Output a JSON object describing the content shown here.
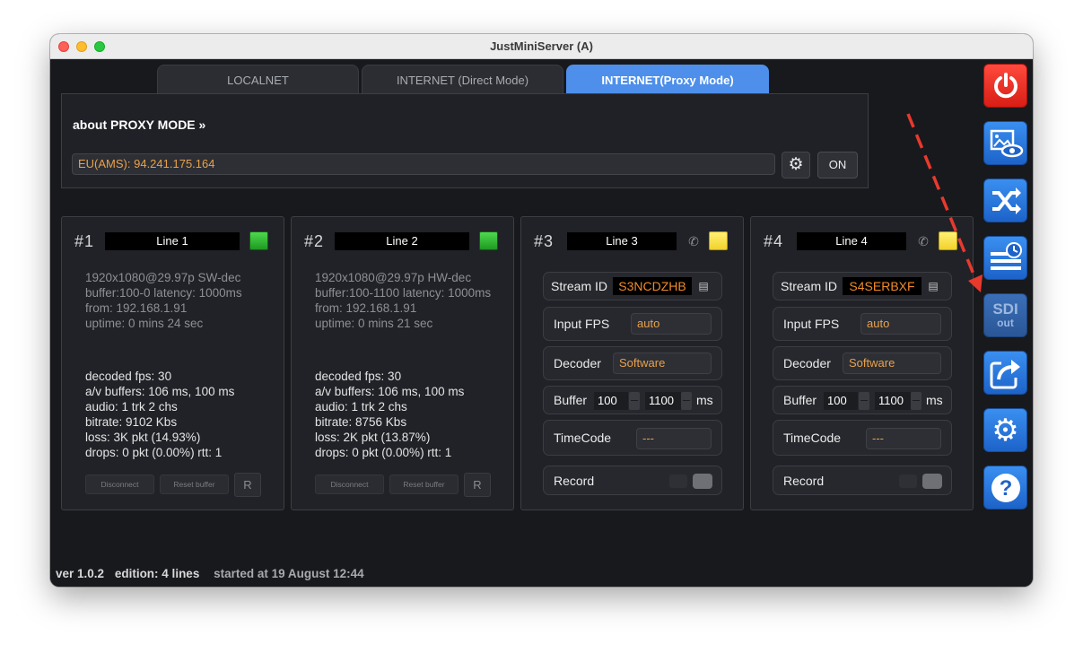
{
  "window": {
    "title": "JustMiniServer (A)"
  },
  "tabs": [
    {
      "label": "LOCALNET",
      "active": false
    },
    {
      "label": "INTERNET (Direct Mode)",
      "active": false
    },
    {
      "label": "INTERNET(Proxy Mode)",
      "active": true
    }
  ],
  "proxy": {
    "about": "about PROXY MODE »",
    "server": "EU(AMS): 94.241.175.164",
    "settings_icon": "gear-icon",
    "on_label": "ON"
  },
  "lines": [
    {
      "number": "#1",
      "name": "Line 1",
      "status_color": "#2fb83a",
      "info": [
        "1920x1080@29.97p SW-dec",
        "buffer:100-0 latency: 1000ms",
        "from: 192.168.1.91",
        "uptime: 0 mins 24 sec"
      ],
      "stats": [
        "decoded fps: 30",
        "a/v buffers: 106 ms, 100 ms",
        "audio: 1 trk 2 chs",
        "bitrate: 9102 Kbs",
        "loss: 3K pkt (14.93%)",
        "drops: 0 pkt (0.00%) rtt: 1"
      ],
      "disconnect_label": "Disconnect",
      "reset_label": "Reset buffer",
      "r_label": "R"
    },
    {
      "number": "#2",
      "name": "Line 2",
      "status_color": "#2fb83a",
      "info": [
        "1920x1080@29.97p HW-dec",
        "buffer:100-1100 latency: 1000ms",
        "from: 192.168.1.91",
        "uptime: 0 mins 21 sec"
      ],
      "stats": [
        "decoded fps: 30",
        "a/v buffers: 106 ms, 100 ms",
        "audio: 1 trk 2 chs",
        "bitrate: 8756 Kbs",
        "loss: 2K pkt (13.87%)",
        "drops: 0 pkt (0.00%) rtt: 1"
      ],
      "disconnect_label": "Disconnect",
      "reset_label": "Reset buffer",
      "r_label": "R"
    },
    {
      "number": "#3",
      "name": "Line 3",
      "status_color": "#f7dd3d",
      "stream_id_label": "Stream ID",
      "stream_id": "S3NCDZHB",
      "input_fps_label": "Input FPS",
      "input_fps": "auto",
      "decoder_label": "Decoder",
      "decoder": "Software",
      "buffer_label": "Buffer",
      "buffer_min": "100",
      "buffer_max": "1100",
      "buffer_unit": "ms",
      "timecode_label": "TimeCode",
      "timecode": "---",
      "record_label": "Record"
    },
    {
      "number": "#4",
      "name": "Line 4",
      "status_color": "#f7dd3d",
      "stream_id_label": "Stream ID",
      "stream_id": "S4SERBXF",
      "input_fps_label": "Input FPS",
      "input_fps": "auto",
      "decoder_label": "Decoder",
      "decoder": "Software",
      "buffer_label": "Buffer",
      "buffer_min": "100",
      "buffer_max": "1100",
      "buffer_unit": "ms",
      "timecode_label": "TimeCode",
      "timecode": "---",
      "record_label": "Record"
    }
  ],
  "sidebar": {
    "power_icon": "power-icon",
    "preview_icon": "image-preview-icon",
    "routing_icon": "shuffle-icon",
    "schedule_icon": "schedule-icon",
    "sdi": {
      "title": "SDI",
      "sub": "out"
    },
    "export_icon": "share-icon",
    "settings_icon": "gear-icon",
    "help_icon": "help-icon"
  },
  "footer": {
    "version": "ver 1.0.2",
    "edition": "edition: 4 lines",
    "started": "started at 19 August 12:44"
  },
  "colors": {
    "accent": "#4d8fea",
    "orange": "#f08a2a",
    "arrow": "#e8392d"
  }
}
